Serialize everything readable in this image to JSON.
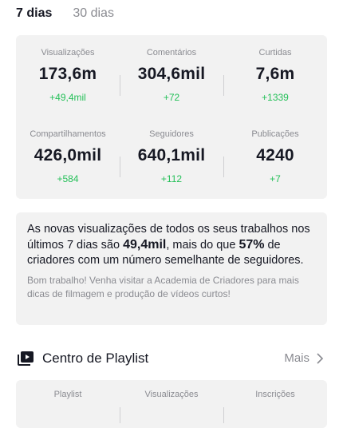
{
  "tabs": [
    {
      "label": "7 dias",
      "active": true
    },
    {
      "label": "30 dias",
      "active": false
    }
  ],
  "stats": [
    {
      "label": "Visualizações",
      "value": "173,6m",
      "delta": "+49,4mil"
    },
    {
      "label": "Comentários",
      "value": "304,6mil",
      "delta": "+72"
    },
    {
      "label": "Curtidas",
      "value": "7,6m",
      "delta": "+1339"
    },
    {
      "label": "Compartilhamentos",
      "value": "426,0mil",
      "delta": "+584"
    },
    {
      "label": "Seguidores",
      "value": "640,1mil",
      "delta": "+112"
    },
    {
      "label": "Publicações",
      "value": "4240",
      "delta": "+7"
    }
  ],
  "insight": {
    "text_1": "As novas visualizações de todos os seus trabalhos nos últimos 7 dias são ",
    "highlight_views": "49,4mil",
    "text_2": ", mais do que ",
    "highlight_percent": "57%",
    "text_3": " de criadores com um número semelhante de seguidores.",
    "sub": "Bom trabalho! Venha visitar a Academia de Criadores para mais dicas de filmagem e produção de vídeos curtos!"
  },
  "playlist": {
    "title": "Centro de Playlist",
    "more_label": "Mais",
    "icon": "playlist-icon",
    "columns": [
      "Playlist",
      "Visualizações",
      "Inscrições"
    ]
  },
  "colors": {
    "positive_delta": "#25c059",
    "card_background": "#f2f2f2",
    "muted_text": "#8a8b91"
  }
}
